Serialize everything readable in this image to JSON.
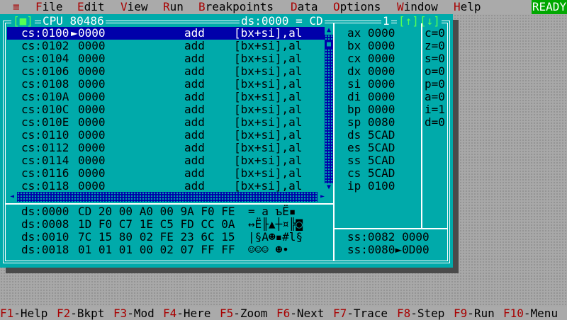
{
  "menubar": {
    "system": "≡",
    "items": [
      {
        "hot": "F",
        "rest": "ile"
      },
      {
        "hot": "E",
        "rest": "dit"
      },
      {
        "hot": "V",
        "rest": "iew"
      },
      {
        "hot": "R",
        "rest": "un"
      },
      {
        "hot": "B",
        "rest": "reakpoints"
      },
      {
        "hot": "D",
        "rest": "ata"
      },
      {
        "hot": "O",
        "rest": "ptions"
      },
      {
        "hot": "W",
        "rest": "indow"
      },
      {
        "hot": "H",
        "rest": "elp"
      }
    ],
    "status": "READY"
  },
  "window": {
    "close_box": "[■]",
    "title": "CPU 80486",
    "ds_display": "ds:0000 = CD",
    "window_number": "1",
    "zoom_up": "[↑]",
    "zoom_down": "[↓]"
  },
  "disassembly": [
    {
      "addr": "cs:0100",
      "marker": "►",
      "bytes": "0000",
      "mnemonic": "add",
      "operands": "[bx+si],al"
    },
    {
      "addr": "cs:0102",
      "marker": " ",
      "bytes": "0000",
      "mnemonic": "add",
      "operands": "[bx+si],al"
    },
    {
      "addr": "cs:0104",
      "marker": " ",
      "bytes": "0000",
      "mnemonic": "add",
      "operands": "[bx+si],al"
    },
    {
      "addr": "cs:0106",
      "marker": " ",
      "bytes": "0000",
      "mnemonic": "add",
      "operands": "[bx+si],al"
    },
    {
      "addr": "cs:0108",
      "marker": " ",
      "bytes": "0000",
      "mnemonic": "add",
      "operands": "[bx+si],al"
    },
    {
      "addr": "cs:010A",
      "marker": " ",
      "bytes": "0000",
      "mnemonic": "add",
      "operands": "[bx+si],al"
    },
    {
      "addr": "cs:010C",
      "marker": " ",
      "bytes": "0000",
      "mnemonic": "add",
      "operands": "[bx+si],al"
    },
    {
      "addr": "cs:010E",
      "marker": " ",
      "bytes": "0000",
      "mnemonic": "add",
      "operands": "[bx+si],al"
    },
    {
      "addr": "cs:0110",
      "marker": " ",
      "bytes": "0000",
      "mnemonic": "add",
      "operands": "[bx+si],al"
    },
    {
      "addr": "cs:0112",
      "marker": " ",
      "bytes": "0000",
      "mnemonic": "add",
      "operands": "[bx+si],al"
    },
    {
      "addr": "cs:0114",
      "marker": " ",
      "bytes": "0000",
      "mnemonic": "add",
      "operands": "[bx+si],al"
    },
    {
      "addr": "cs:0116",
      "marker": " ",
      "bytes": "0000",
      "mnemonic": "add",
      "operands": "[bx+si],al"
    },
    {
      "addr": "cs:0118",
      "marker": " ",
      "bytes": "0000",
      "mnemonic": "add",
      "operands": "[bx+si],al"
    }
  ],
  "registers": [
    {
      "name": "ax",
      "value": "0000"
    },
    {
      "name": "bx",
      "value": "0000"
    },
    {
      "name": "cx",
      "value": "0000"
    },
    {
      "name": "dx",
      "value": "0000"
    },
    {
      "name": "si",
      "value": "0000"
    },
    {
      "name": "di",
      "value": "0000"
    },
    {
      "name": "bp",
      "value": "0000"
    },
    {
      "name": "sp",
      "value": "0080"
    },
    {
      "name": "ds",
      "value": "5CAD"
    },
    {
      "name": "es",
      "value": "5CAD"
    },
    {
      "name": "ss",
      "value": "5CAD"
    },
    {
      "name": "cs",
      "value": "5CAD"
    },
    {
      "name": "ip",
      "value": "0100"
    }
  ],
  "flags": [
    {
      "name": "c",
      "value": "0"
    },
    {
      "name": "z",
      "value": "0"
    },
    {
      "name": "s",
      "value": "0"
    },
    {
      "name": "o",
      "value": "0"
    },
    {
      "name": "p",
      "value": "0"
    },
    {
      "name": "a",
      "value": "0"
    },
    {
      "name": "i",
      "value": "1"
    },
    {
      "name": "d",
      "value": "0"
    }
  ],
  "dump": [
    {
      "addr": "ds:0000",
      "bytes": "CD 20 00 A0 00 9A F0 FE",
      "ascii": "= a ъЁ▪"
    },
    {
      "addr": "ds:0008",
      "bytes": "1D F0 C7 1E C5 FD CC 0A",
      "ascii": "↔Ё╟▲┼¤╠◙"
    },
    {
      "addr": "ds:0010",
      "bytes": "7C 15 80 02 FE 23 6C 15",
      "ascii": "|§А☻▪#l§"
    },
    {
      "addr": "ds:0018",
      "bytes": "01 01 01 00 02 07 FF FF",
      "ascii": "☺☺☺ ☻•"
    }
  ],
  "stack": [
    {
      "addr": "ss:0082",
      "marker": " ",
      "value": "0000"
    },
    {
      "addr": "ss:0080",
      "marker": "►",
      "value": "0D00"
    }
  ],
  "function_keys": [
    {
      "key": "F1",
      "label": "-Help"
    },
    {
      "key": "F2",
      "label": "-Bkpt"
    },
    {
      "key": "F3",
      "label": "-Mod"
    },
    {
      "key": "F4",
      "label": "-Here"
    },
    {
      "key": "F5",
      "label": "-Zoom"
    },
    {
      "key": "F6",
      "label": "-Next"
    },
    {
      "key": "F7",
      "label": "-Trace"
    },
    {
      "key": "F8",
      "label": "-Step"
    },
    {
      "key": "F9",
      "label": "-Run"
    },
    {
      "key": "F10",
      "label": "-Menu"
    }
  ],
  "scroll_arrows": {
    "up": "▲",
    "down": "▼",
    "left": "◄",
    "right": "►"
  },
  "colors": {
    "desktop": "#a8a8a8",
    "window": "#00aaaa",
    "selection": "#0000aa",
    "hotkey": "#a80000",
    "ready": "#00a800"
  }
}
